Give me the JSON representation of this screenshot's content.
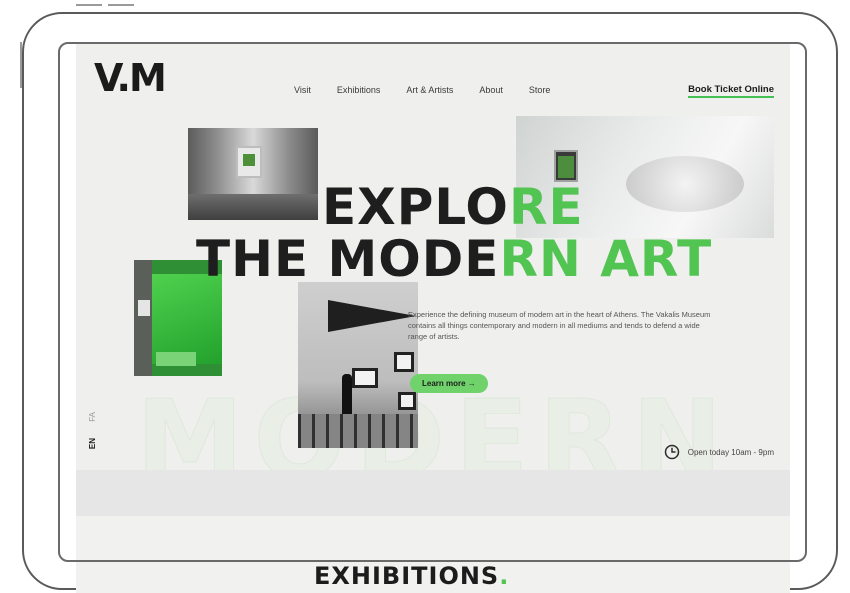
{
  "site": {
    "logo": "V.M",
    "nav": [
      "Visit",
      "Exhibitions",
      "Art & Artists",
      "About",
      "Store"
    ],
    "book_ticket": "Book Ticket Online"
  },
  "hero": {
    "line1_dark": "EXPLO",
    "line1_green": "RE",
    "line2_dark": "THE MODE",
    "line2_green": "RN ART",
    "description": "Experience the defining museum of modern art in the heart of Athens. The Vakalis Museum contains all things contemporary and modern in all mediums and tends to defend a wide range of artists.",
    "cta": "Learn more →",
    "background_word": "MODERN"
  },
  "languages": {
    "active": "EN",
    "other": "FA"
  },
  "hours": {
    "text": "Open today 10am - 9pm",
    "icon": "clock-icon"
  },
  "next_section": {
    "title": "EXHIBITIONS",
    "dot": "."
  },
  "colors": {
    "accent": "#52c452",
    "text": "#1e1e1e",
    "background": "#efefed"
  }
}
